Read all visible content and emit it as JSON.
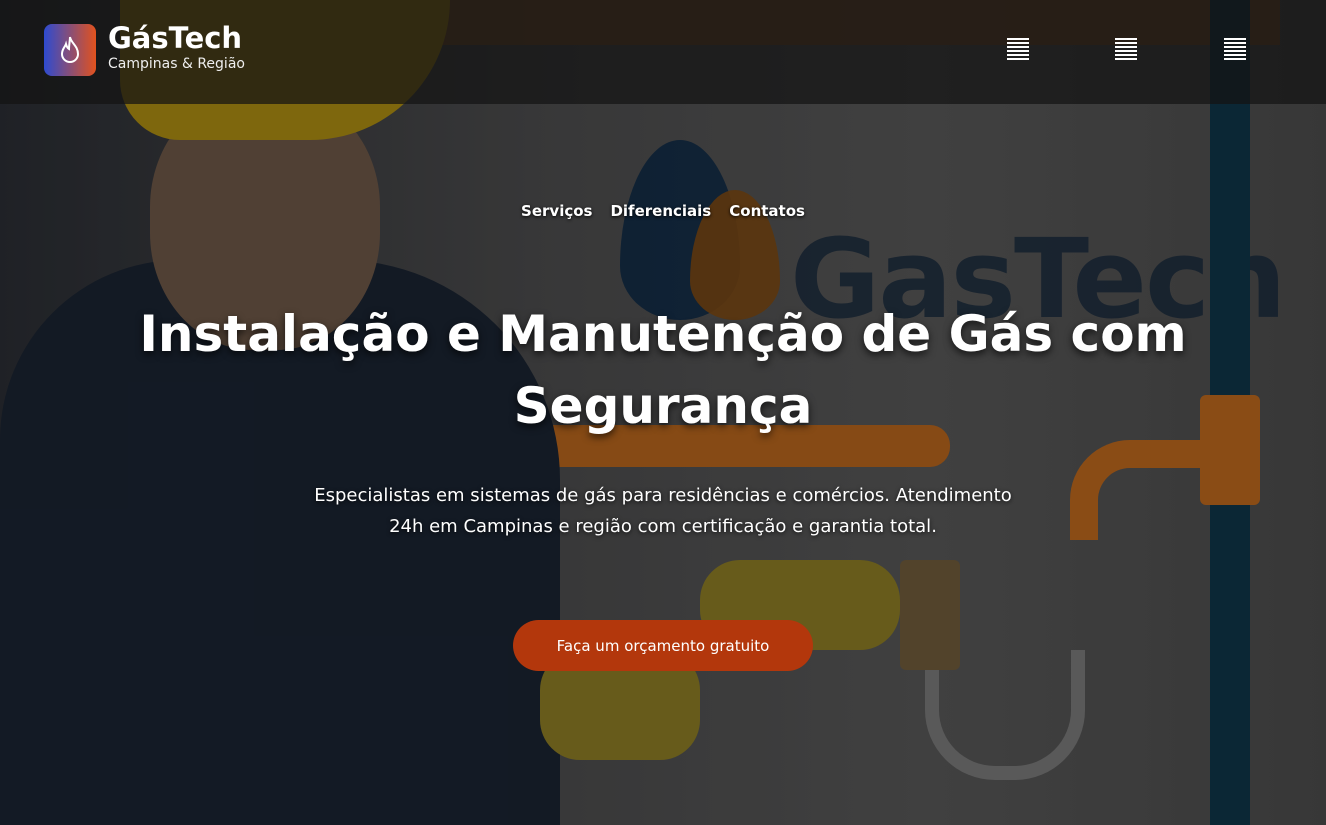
{
  "header": {
    "brand": "GásTech",
    "tagline": "Campinas & Região",
    "logo_icon": "flame-icon",
    "menu_icons": [
      "menu-icon",
      "menu-icon",
      "menu-icon"
    ]
  },
  "nav": {
    "items": [
      {
        "label": "Serviços"
      },
      {
        "label": "Diferenciais"
      },
      {
        "label": "Contatos"
      }
    ]
  },
  "hero": {
    "watermark": "GasTech",
    "title": "Instalação e Manutenção de Gás com Segurança",
    "subtitle": "Especialistas em sistemas de gás para residências e comércios. Atendimento 24h em Campinas e região com certificação e garantia total.",
    "cta_label": "Faça um orçamento gratuito"
  },
  "colors": {
    "accent": "#b3370c",
    "logo_from": "#2e4bd0",
    "logo_to": "#e2521e"
  }
}
